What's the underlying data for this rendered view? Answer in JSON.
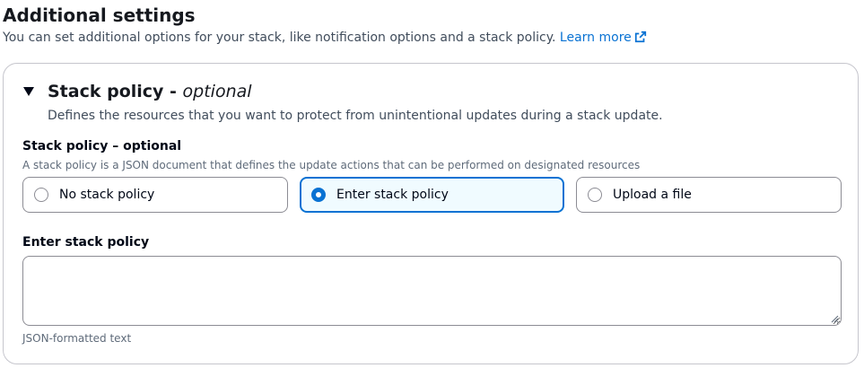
{
  "header": {
    "title": "Additional settings",
    "description": "You can set additional options for your stack, like notification options and a stack policy.",
    "learn_more": "Learn more",
    "external_icon": "external-link-icon"
  },
  "section": {
    "title": "Stack policy - ",
    "title_optional": "optional",
    "description": "Defines the resources that you want to protect from unintentional updates during a stack update.",
    "expanded": true,
    "caret_icon": "caret-down-icon"
  },
  "radio_group": {
    "label": "Stack policy – optional",
    "description": "A stack policy is a JSON document that defines the update actions that can be performed on designated resources",
    "options": [
      {
        "label": "No stack policy",
        "selected": false
      },
      {
        "label": "Enter stack policy",
        "selected": true
      },
      {
        "label": "Upload a file",
        "selected": false
      }
    ]
  },
  "policy_input": {
    "label": "Enter stack policy",
    "value": "",
    "constraint": "JSON-formatted text"
  },
  "colors": {
    "link": "#0972d3",
    "selected_border": "#0972d3",
    "selected_background": "#f0fbff",
    "border": "#8c8c94"
  }
}
